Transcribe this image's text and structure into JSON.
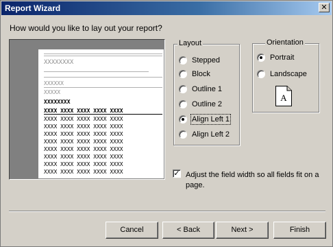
{
  "window": {
    "title": "Report Wizard",
    "close_glyph": "✕"
  },
  "prompt": "How would you like to lay out your report?",
  "preview": {
    "header_mark": "XXXXXXXX",
    "group1_mark": "XXXXXX",
    "group2_mark": "XXXXX",
    "group3_mark": "XXXXXXXX",
    "column_header_row": "XXXX XXXX XXXX XXXX XXXX",
    "data_row": "XXXX XXXX XXXX XXXX XXXX"
  },
  "layout": {
    "legend": "Layout",
    "options": [
      {
        "label": "Stepped",
        "selected": false
      },
      {
        "label": "Block",
        "selected": false
      },
      {
        "label": "Outline 1",
        "selected": false
      },
      {
        "label": "Outline 2",
        "selected": false
      },
      {
        "label": "Align Left 1",
        "selected": true
      },
      {
        "label": "Align Left 2",
        "selected": false
      }
    ]
  },
  "orientation": {
    "legend": "Orientation",
    "options": [
      {
        "label": "Portrait",
        "selected": true
      },
      {
        "label": "Landscape",
        "selected": false
      }
    ],
    "paper_letter": "A"
  },
  "adjust": {
    "checked": true,
    "check_glyph": "✓",
    "label": "Adjust the field width so all fields fit on a page."
  },
  "buttons": {
    "cancel": "Cancel",
    "back": "< Back",
    "next": "Next >",
    "finish": "Finish"
  }
}
